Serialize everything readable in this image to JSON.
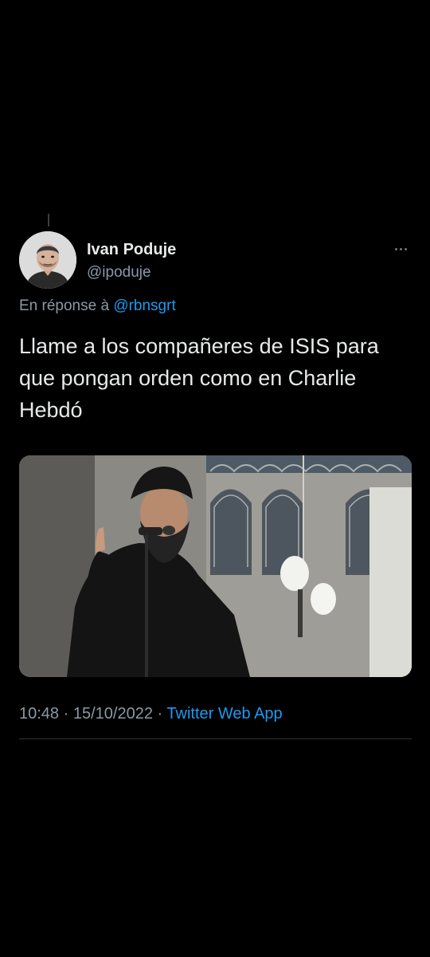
{
  "tweet": {
    "author_name": "Ivan Poduje",
    "author_handle": "@ipoduje",
    "reply_prefix": "En réponse à",
    "reply_to": "@rbnsgrt",
    "text": "Llame a los compañeres de ISIS para que pongan orden como en Charlie Hebdó",
    "time": "10:48",
    "separator": "·",
    "date": "15/10/2022",
    "source": "Twitter Web App"
  },
  "icons": {
    "more": "more-horizontal-icon"
  },
  "colors": {
    "background": "#000000",
    "primary_text": "#e7e9ea",
    "secondary_text": "#8b98a5",
    "link": "#1d9bf0",
    "divider": "#2f3336"
  }
}
